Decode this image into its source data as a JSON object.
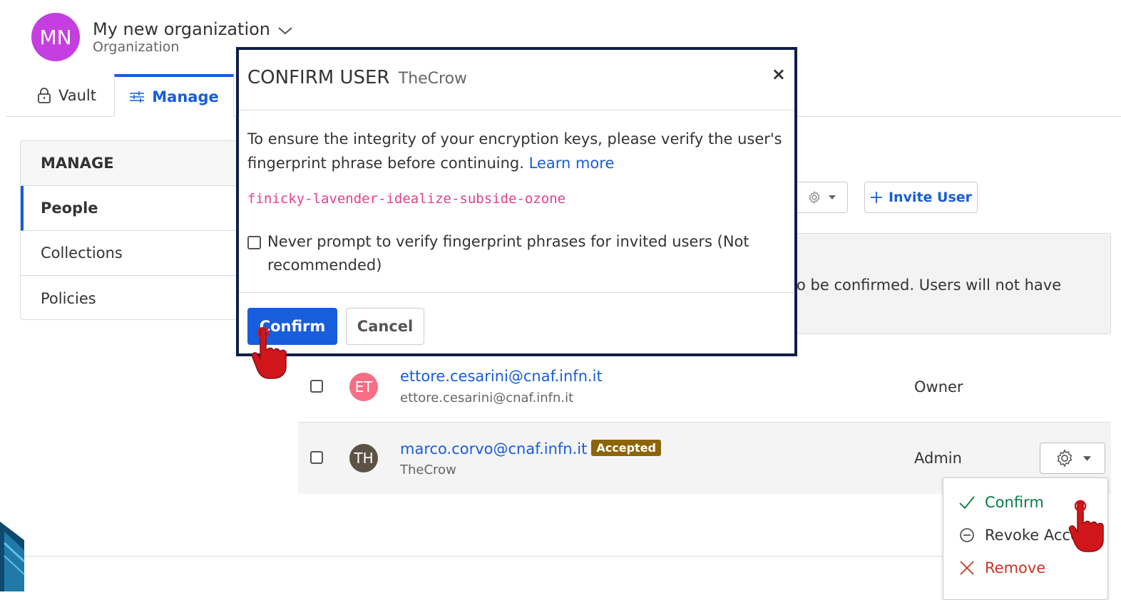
{
  "header": {
    "avatar_initials": "MN",
    "org_name": "My new organization",
    "org_type": "Organization"
  },
  "tabs": [
    {
      "label": "Vault",
      "icon": "lock-icon"
    },
    {
      "label": "Manage",
      "icon": "sliders-icon",
      "active": true
    }
  ],
  "sidebar": {
    "heading": "MANAGE",
    "items": [
      {
        "label": "People",
        "active": true
      },
      {
        "label": "Collections"
      },
      {
        "label": "Policies"
      }
    ]
  },
  "toolbar": {
    "invite_label": "Invite User"
  },
  "callout": {
    "text_fragment": "o be confirmed. Users will not have"
  },
  "users": [
    {
      "initials": "ET",
      "avatar_color": "#f76e86",
      "email": "ettore.cesarini@cnaf.infn.it",
      "sub": "ettore.cesarini@cnaf.infn.it",
      "role": "Owner"
    },
    {
      "initials": "TH",
      "avatar_color": "#5c5346",
      "email": "marco.corvo@cnaf.infn.it",
      "badge": "Accepted",
      "sub": "TheCrow",
      "role": "Admin"
    }
  ],
  "dropdown": {
    "confirm": "Confirm",
    "revoke": "Revoke Acce",
    "remove": "Remove"
  },
  "modal": {
    "title": "CONFIRM USER",
    "title_sub": "TheCrow",
    "close": "×",
    "text": "To ensure the integrity of your encryption keys, please verify the user's fingerprint phrase before continuing.",
    "learn_more": "Learn more",
    "fingerprint": "finicky-lavender-idealize-subside-ozone",
    "checkbox_label": "Never prompt to verify fingerprint phrases for invited users (Not recommended)",
    "confirm_button": "Confirm",
    "cancel_button": "Cancel"
  },
  "colors": {
    "primary": "#175ddc",
    "modal_border": "#0e1e48",
    "fingerprint": "#e83e8c",
    "badge": "#8b6508",
    "confirm_green": "#017e45",
    "remove_red": "#c83522",
    "pointer_hand": "#d0161b"
  }
}
